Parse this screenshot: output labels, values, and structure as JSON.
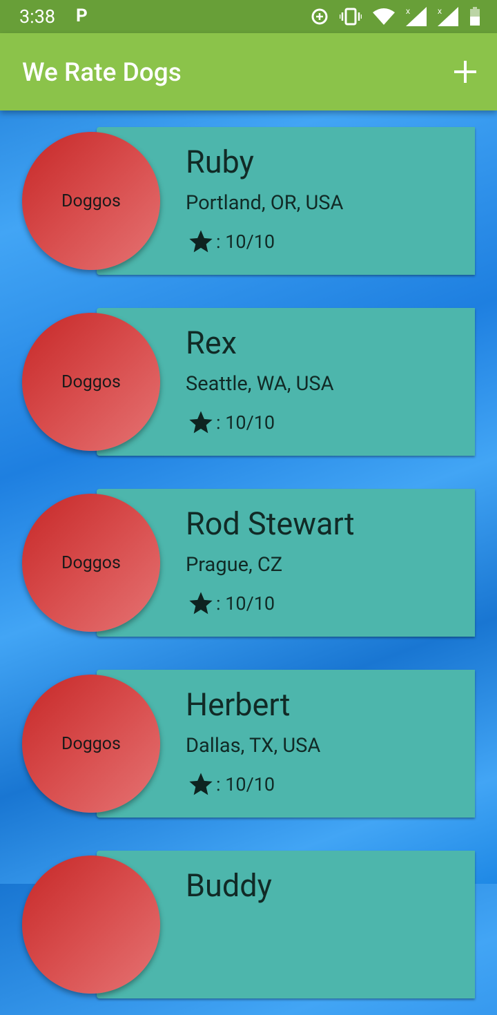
{
  "status_bar": {
    "time": "3:38",
    "notification_icon": "P",
    "icons": [
      "data-saver-icon",
      "vibrate-icon",
      "wifi-icon",
      "signal-icon",
      "signal-icon",
      "battery-icon"
    ]
  },
  "app_bar": {
    "title": "We Rate Dogs",
    "action_icon": "add-icon"
  },
  "dogs": [
    {
      "name": "Ruby",
      "location": "Portland, OR, USA",
      "avatar_label": "Doggos",
      "rating": ": 10/10"
    },
    {
      "name": "Rex",
      "location": "Seattle, WA, USA",
      "avatar_label": "Doggos",
      "rating": ": 10/10"
    },
    {
      "name": "Rod Stewart",
      "location": "Prague, CZ",
      "avatar_label": "Doggos",
      "rating": ": 10/10"
    },
    {
      "name": "Herbert",
      "location": "Dallas, TX, USA",
      "avatar_label": "Doggos",
      "rating": ": 10/10"
    },
    {
      "name": "Buddy",
      "location": "",
      "avatar_label": "",
      "rating": ""
    }
  ],
  "colors": {
    "status_bar": "#689f38",
    "app_bar": "#8bc34a",
    "card": "#4db6ac",
    "avatar": "#d84d4d",
    "background": "#2196f3"
  }
}
